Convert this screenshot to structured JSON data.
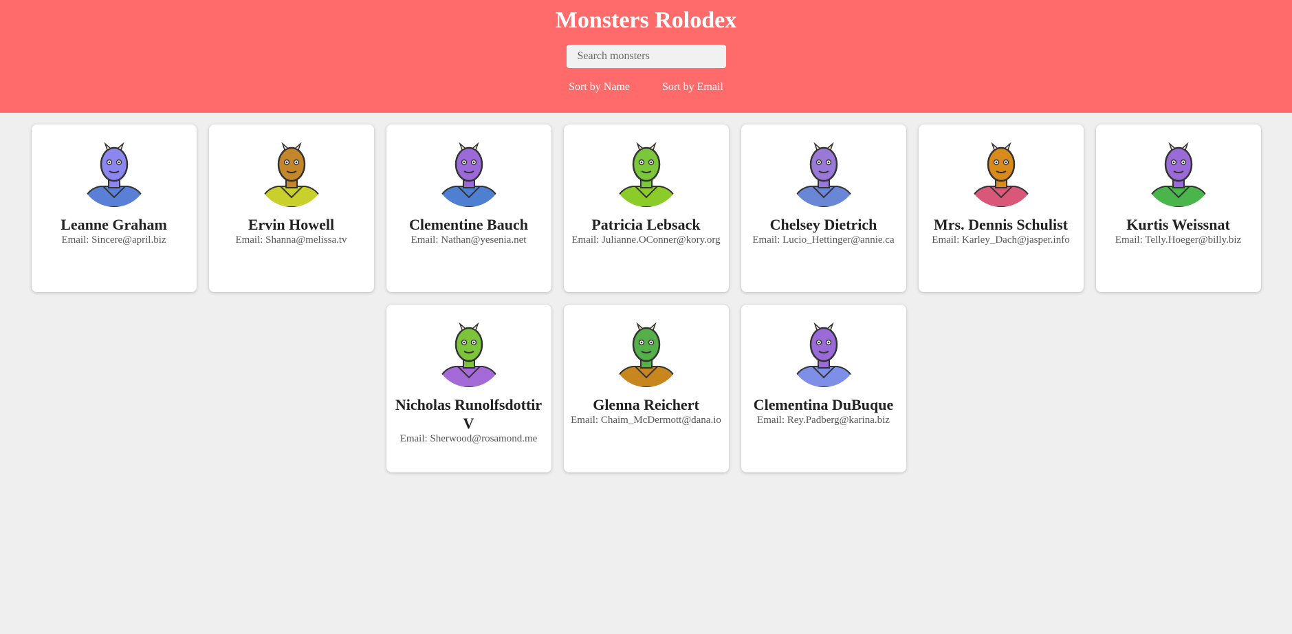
{
  "header": {
    "title": "Monsters Rolodex",
    "search_placeholder": "Search monsters",
    "sort_name_label": "Sort by Name",
    "sort_email_label": "Sort by Email"
  },
  "colors": {
    "header_bg": "#ff6b6b",
    "page_bg": "#efefef"
  },
  "monsters": [
    {
      "name": "Leanne Graham",
      "email": "Email: Sincere@april.biz",
      "skin": "#8c86f0",
      "body": "#5a7fd6",
      "icon": "blue-horned-monster-icon"
    },
    {
      "name": "Ervin Howell",
      "email": "Email: Shanna@melissa.tv",
      "skin": "#c4862a",
      "body": "#c9cf2b",
      "icon": "orange-monster-icon"
    },
    {
      "name": "Clementine Bauch",
      "email": "Email: Nathan@yesenia.net",
      "skin": "#9b6ad8",
      "body": "#4f7fd0",
      "icon": "purple-cyclops-monster-icon"
    },
    {
      "name": "Patricia Lebsack",
      "email": "Email: Julianne.OConner@kory.org",
      "skin": "#7bc63a",
      "body": "#8ccc29",
      "icon": "green-robot-monster-icon"
    },
    {
      "name": "Chelsey Dietrich",
      "email": "Email: Lucio_Hettinger@annie.ca",
      "skin": "#9a78d8",
      "body": "#6a86d6",
      "icon": "purple-helmet-monster-icon"
    },
    {
      "name": "Mrs. Dennis Schulist",
      "email": "Email: Karley_Dach@jasper.info",
      "skin": "#d88a1c",
      "body": "#d9587a",
      "icon": "orange-antenna-monster-icon"
    },
    {
      "name": "Kurtis Weissnat",
      "email": "Email: Telly.Hoeger@billy.biz",
      "skin": "#9a6ad8",
      "body": "#4ab54a",
      "icon": "purple-unicorn-monster-icon"
    },
    {
      "name": "Nicholas Runolfsdottir V",
      "email": "Email: Sherwood@rosamond.me",
      "skin": "#7cc43a",
      "body": "#a46ad8",
      "icon": "green-headphone-monster-icon"
    },
    {
      "name": "Glenna Reichert",
      "email": "Email: Chaim_McDermott@dana.io",
      "skin": "#55b04a",
      "body": "#c8861f",
      "icon": "green-horned-monster-icon"
    },
    {
      "name": "Clementina DuBuque",
      "email": "Email: Rey.Padberg@karina.biz",
      "skin": "#9a6ad8",
      "body": "#7e8fe8",
      "icon": "purple-smiley-monster-icon"
    }
  ]
}
